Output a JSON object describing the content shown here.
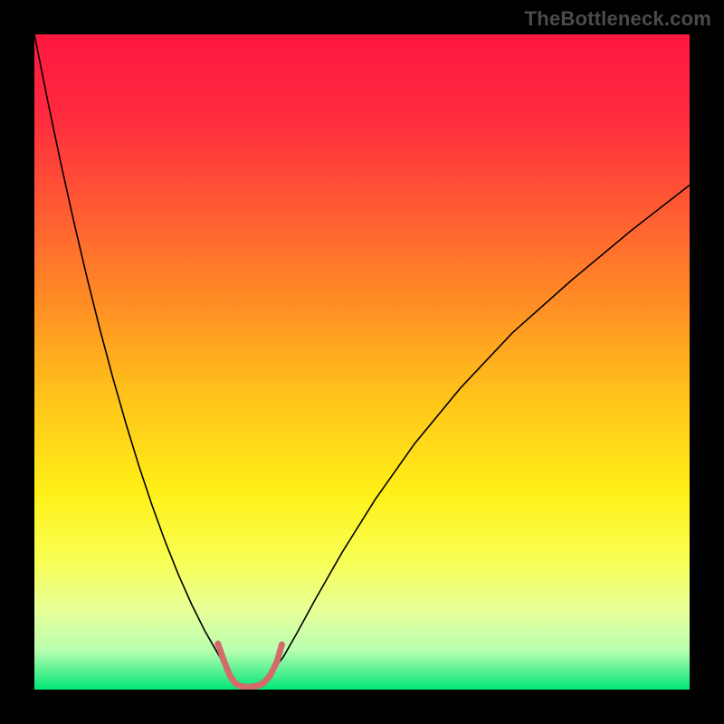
{
  "watermark": "TheBottleneck.com",
  "chart_data": {
    "type": "line",
    "title": "",
    "xlabel": "",
    "ylabel": "",
    "xlim": [
      0,
      100
    ],
    "ylim": [
      0,
      100
    ],
    "grid": false,
    "legend": false,
    "background_gradient": {
      "stops": [
        {
          "t": 0.0,
          "color": "#ff173f"
        },
        {
          "t": 0.12,
          "color": "#ff2a3f"
        },
        {
          "t": 0.25,
          "color": "#ff5534"
        },
        {
          "t": 0.4,
          "color": "#ff8a26"
        },
        {
          "t": 0.55,
          "color": "#ffc21a"
        },
        {
          "t": 0.7,
          "color": "#fff018"
        },
        {
          "t": 0.8,
          "color": "#f8ff52"
        },
        {
          "t": 0.88,
          "color": "#e8ff9a"
        },
        {
          "t": 0.94,
          "color": "#b8ffb0"
        },
        {
          "t": 1.0,
          "color": "#00e676"
        }
      ]
    },
    "series": [
      {
        "name": "left-arm",
        "style": {
          "stroke": "#000000",
          "width": 1.6,
          "dash": null
        },
        "x": [
          0,
          2,
          4,
          6,
          8,
          10,
          12,
          14,
          16,
          18,
          20,
          22,
          24,
          26,
          28,
          29.5
        ],
        "y": [
          100,
          90,
          80.5,
          71.5,
          63,
          55,
          47.5,
          40.5,
          34,
          28,
          22.5,
          17.5,
          13,
          9,
          5.5,
          3.0
        ]
      },
      {
        "name": "right-arm",
        "style": {
          "stroke": "#000000",
          "width": 1.6,
          "dash": null
        },
        "x": [
          36.5,
          38,
          40,
          43,
          47,
          52,
          58,
          65,
          73,
          82,
          91,
          100
        ],
        "y": [
          3.0,
          5.0,
          8.5,
          14.0,
          21.0,
          29.0,
          37.5,
          46.0,
          54.5,
          62.5,
          70.0,
          77.0
        ]
      },
      {
        "name": "valley-marker",
        "style": {
          "stroke": "#d46a6a",
          "width": 7.0,
          "dash": [
            2.8,
            3.2
          ],
          "cap": "round"
        },
        "x": [
          28.0,
          29.0,
          29.8,
          30.6,
          31.5,
          32.6,
          33.8,
          35.0,
          36.0,
          37.0,
          37.8
        ],
        "y": [
          7.0,
          4.2,
          2.2,
          1.0,
          0.5,
          0.4,
          0.5,
          1.0,
          2.2,
          4.2,
          7.0
        ]
      }
    ]
  },
  "frame": {
    "outer_w": 800,
    "outer_h": 800,
    "inner_x": 38,
    "inner_y": 38,
    "inner_w": 724,
    "inner_h": 724
  },
  "attribution_color": "#4b4b4b"
}
